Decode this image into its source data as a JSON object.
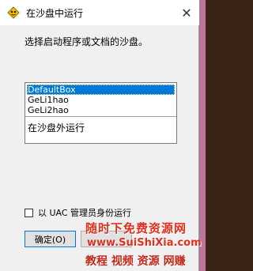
{
  "window": {
    "title": "在沙盘中运行",
    "close_glyph": "✕"
  },
  "prompt": "选择启动程序或文档的沙盘。",
  "sandbox_list": {
    "items": [
      {
        "label": "DefaultBox",
        "selected": true
      },
      {
        "label": "GeLi1hao",
        "selected": false
      },
      {
        "label": "GeLi2hao",
        "selected": false
      }
    ],
    "outside_label": "在沙盘外运行"
  },
  "admin_checkbox": {
    "label": "以 UAC 管理员身份运行",
    "checked": false
  },
  "buttons": {
    "ok_label": "确定(O)"
  },
  "watermark": {
    "line1": "随时下免费资源网",
    "line2": "www.SuiShiXia.com",
    "line3": "教程 视频 资源 网赚"
  },
  "colors": {
    "selection": "#0078d7",
    "watermark_red": "#e0301e"
  }
}
